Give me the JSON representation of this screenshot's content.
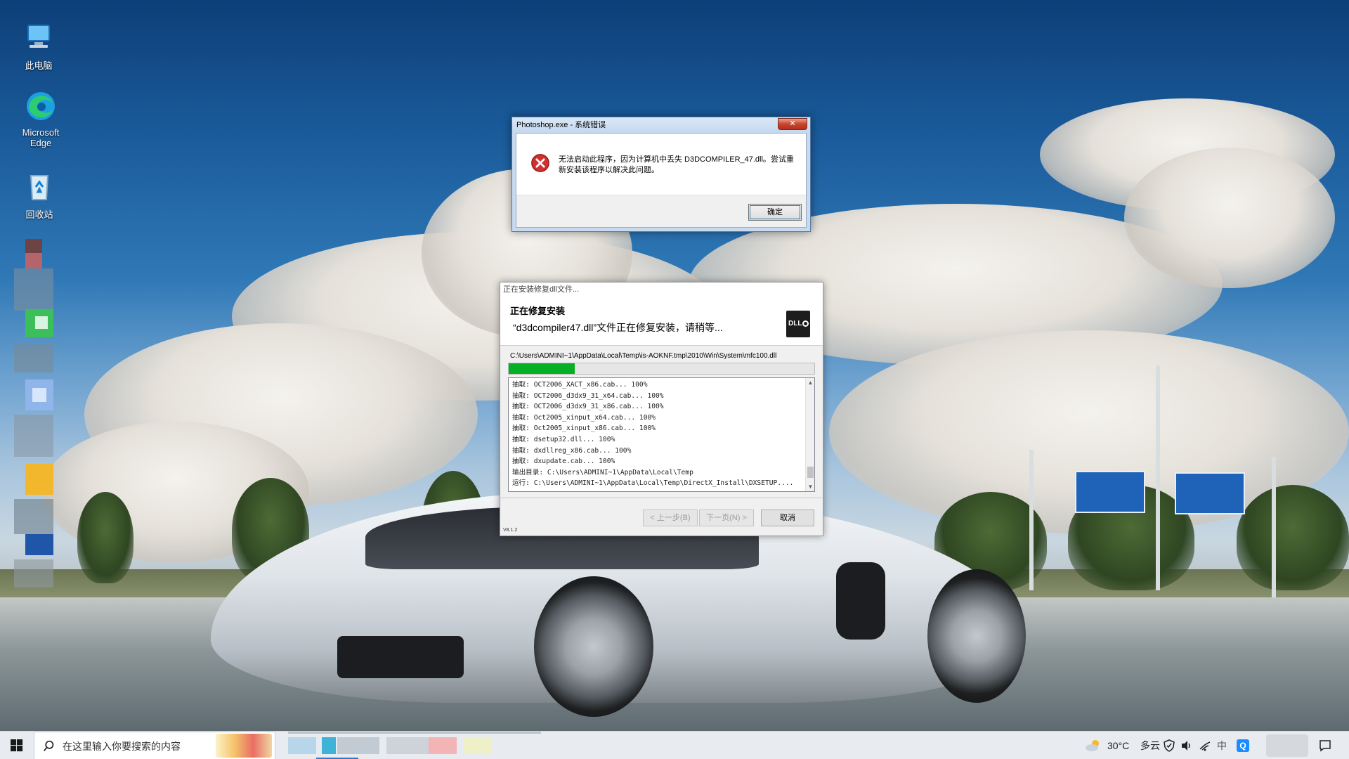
{
  "desktop": {
    "icons": [
      {
        "label": "此电脑",
        "icon": "computer-icon"
      },
      {
        "label": "Microsoft Edge",
        "icon": "edge-icon"
      },
      {
        "label": "回收站",
        "icon": "recycle-bin-icon"
      }
    ]
  },
  "error_dialog": {
    "title": "Photoshop.exe - 系统错误",
    "close_glyph": "✕",
    "message_line1": "无法启动此程序，因为计算机中丢失 D3DCOMPILER_47.dll。尝试重",
    "message_line2": "新安装该程序以解决此问题。",
    "ok_label": "确定",
    "icon": "error-x-icon",
    "accent": "#d32f2f"
  },
  "installer": {
    "title": "正在安装修复dll文件...",
    "heading": "正在修复安装",
    "subheading": "“d3dcompiler47.dll”文件正在修复安装，请稍等...",
    "logo_text": "DLL",
    "current_path": "C:\\Users\\ADMINI~1\\AppData\\Local\\Temp\\is-AOKNF.tmp\\2010\\Win\\System\\mfc100.dll",
    "progress_fraction": 0.215,
    "progress_color": "#06b025",
    "log_lines": [
      "抽取: OCT2006_XACT_x86.cab... 100%",
      "抽取: OCT2006_d3dx9_31_x64.cab... 100%",
      "抽取: OCT2006_d3dx9_31_x86.cab... 100%",
      "抽取: Oct2005_xinput_x64.cab... 100%",
      "抽取: Oct2005_xinput_x86.cab... 100%",
      "抽取: dsetup32.dll... 100%",
      "抽取: dxdllreg_x86.cab... 100%",
      "抽取: dxupdate.cab... 100%",
      "输出目录: C:\\Users\\ADMINI~1\\AppData\\Local\\Temp",
      "运行: C:\\Users\\ADMINI~1\\AppData\\Local\\Temp\\DirectX_Install\\DXSETUP...."
    ],
    "version": "V8.1.2",
    "back_label": "< 上一步(B)",
    "next_label": "下一页(N) >",
    "cancel_label": "取消"
  },
  "taskbar": {
    "search_placeholder": "在这里输入你要搜索的内容",
    "weather_temp": "30°C",
    "weather_desc": "多云",
    "ime_label": "中",
    "tray_app_label": "Q"
  }
}
